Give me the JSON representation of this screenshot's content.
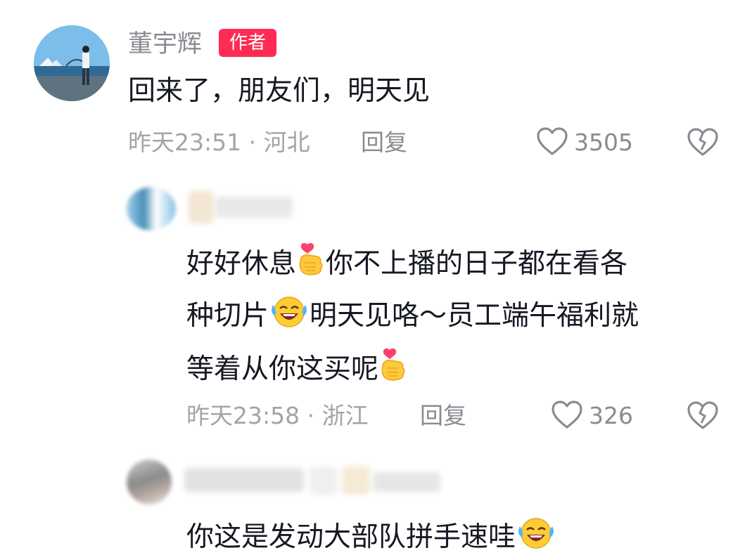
{
  "comments": [
    {
      "user": "董宇辉",
      "badge": "作者",
      "text": "回来了，朋友们，明天见",
      "time": "昨天23:51",
      "location": "河北",
      "reply": "回复",
      "likes": "3505"
    },
    {
      "text_line1_a": "好好休息",
      "text_line1_b": "你不上播的日子都在看各",
      "text_line2_a": "种切片",
      "text_line2_b": "明天见咯～员工端午福利就",
      "text_line3": "等着从你这买呢",
      "time": "昨天23:58",
      "location": "浙江",
      "reply": "回复",
      "likes": "326"
    },
    {
      "text": "你这是发动大部队拼手速哇"
    }
  ],
  "separator": " · ",
  "icons": {
    "like": "heart-outline-icon",
    "dislike": "broken-heart-icon",
    "finger_heart": "finger-heart-emoji",
    "laugh_cry": "laugh-cry-emoji"
  },
  "colors": {
    "badge": "#fe2c55",
    "meta": "#a3a4a8"
  }
}
